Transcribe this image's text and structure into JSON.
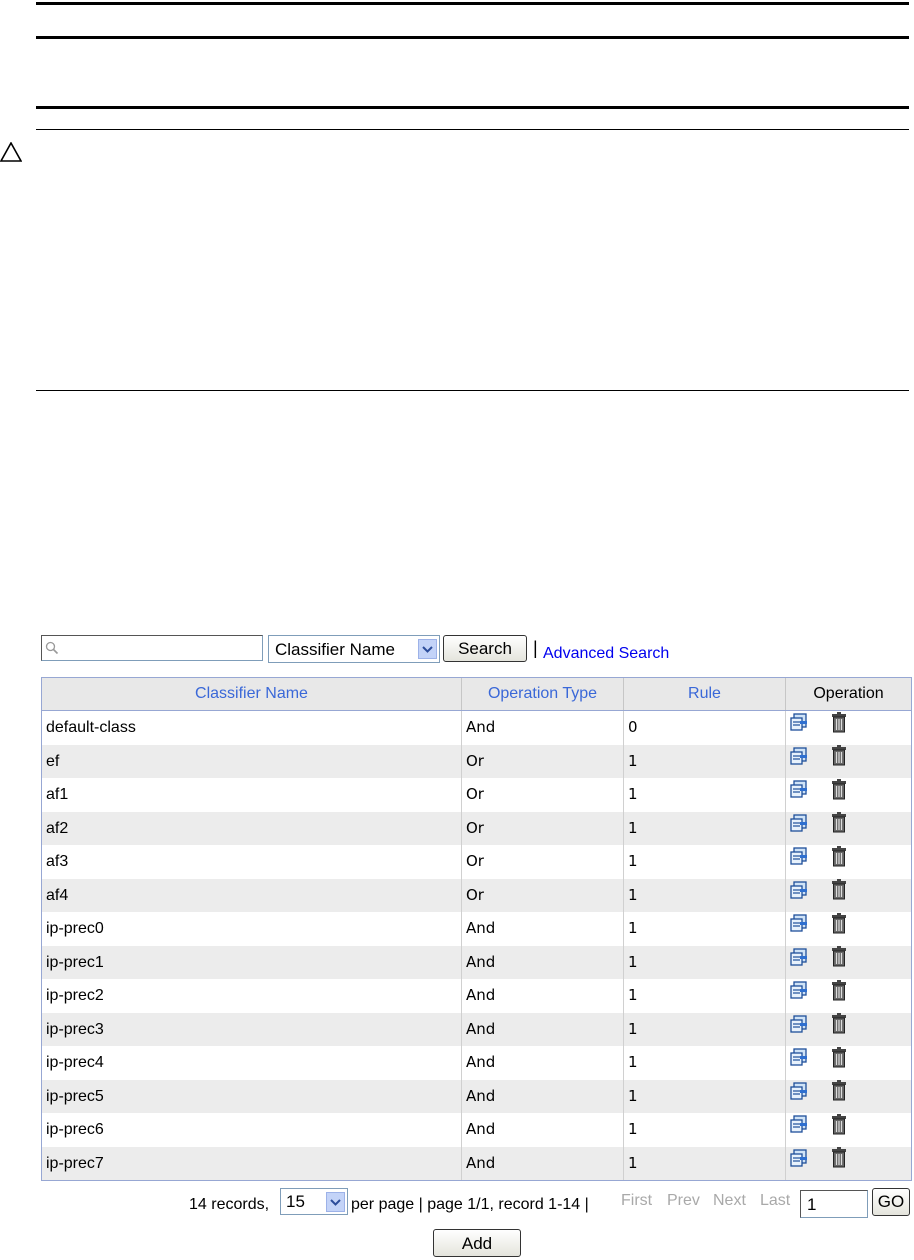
{
  "search": {
    "input_value": "",
    "field_select": "Classifier Name",
    "search_label": "Search",
    "separator": "|",
    "advanced_label": "Advanced Search"
  },
  "table": {
    "headers": [
      "Classifier Name",
      "Operation Type",
      "Rule",
      "Operation"
    ],
    "rows": [
      {
        "name": "default-class",
        "type": "And",
        "rule": "0"
      },
      {
        "name": "ef",
        "type": "Or",
        "rule": "1"
      },
      {
        "name": "af1",
        "type": "Or",
        "rule": "1"
      },
      {
        "name": "af2",
        "type": "Or",
        "rule": "1"
      },
      {
        "name": "af3",
        "type": "Or",
        "rule": "1"
      },
      {
        "name": "af4",
        "type": "Or",
        "rule": "1"
      },
      {
        "name": "ip-prec0",
        "type": "And",
        "rule": "1"
      },
      {
        "name": "ip-prec1",
        "type": "And",
        "rule": "1"
      },
      {
        "name": "ip-prec2",
        "type": "And",
        "rule": "1"
      },
      {
        "name": "ip-prec3",
        "type": "And",
        "rule": "1"
      },
      {
        "name": "ip-prec4",
        "type": "And",
        "rule": "1"
      },
      {
        "name": "ip-prec5",
        "type": "And",
        "rule": "1"
      },
      {
        "name": "ip-prec6",
        "type": "And",
        "rule": "1"
      },
      {
        "name": "ip-prec7",
        "type": "And",
        "rule": "1"
      }
    ],
    "operation_icons": [
      "edit-icon",
      "delete-icon"
    ]
  },
  "pagination": {
    "records_text": "14 records,",
    "per_page_value": "15",
    "page_text": "per page | page 1/1, record 1-14 |",
    "first": "First",
    "prev": "Prev",
    "next": "Next",
    "last": "Last",
    "page_input": "1",
    "go_label": "GO"
  },
  "add_label": "Add",
  "colors": {
    "header_link": "#3a68d8",
    "link": "#0000ee",
    "disabled_nav": "#a9a9a9",
    "row_alt": "#ececec"
  }
}
